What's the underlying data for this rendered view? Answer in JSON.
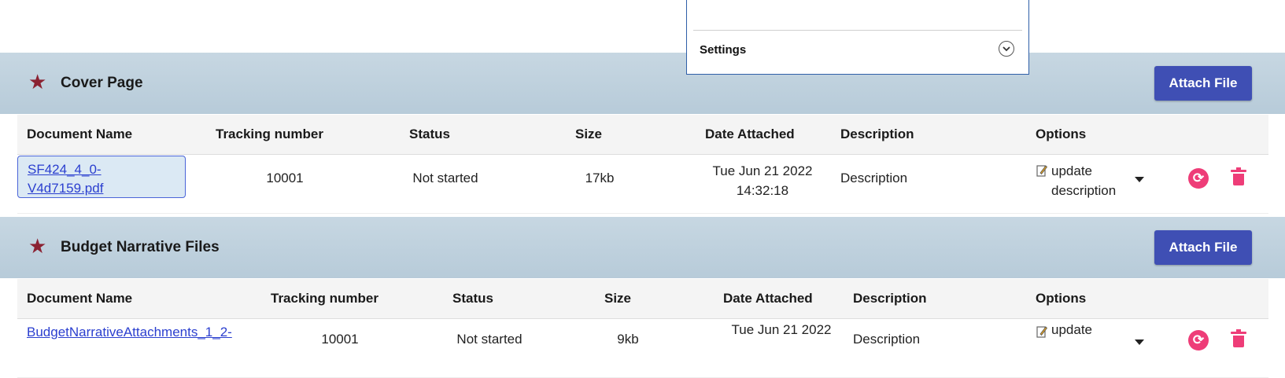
{
  "settings_popup": {
    "label": "Settings"
  },
  "sections": [
    {
      "title": "Cover Page",
      "attach_label": "Attach File",
      "headers": [
        "Document Name",
        "Tracking number",
        "Status",
        "Size",
        "Date Attached",
        "Description",
        "Options"
      ],
      "row": {
        "doc_line1": "SF424_4_0-",
        "doc_line2": "V4d7159.pdf",
        "tracking": "10001",
        "status": "Not started",
        "size": "17kb",
        "date_line1": "Tue Jun 21 2022",
        "date_line2": "14:32:18",
        "description": "Description",
        "option_line1": "update",
        "option_line2": "description"
      }
    },
    {
      "title": "Budget Narrative Files",
      "attach_label": "Attach File",
      "headers": [
        "Document Name",
        "Tracking number",
        "Status",
        "Size",
        "Date Attached",
        "Description",
        "Options"
      ],
      "row": {
        "doc_line1": "BudgetNarrativeAttachments_1_2-",
        "tracking": "10001",
        "status": "Not started",
        "size": "9kb",
        "date_line1": "Tue Jun 21 2022",
        "description": "Description",
        "option_line1": "update"
      }
    }
  ],
  "icons": {
    "star": "star-icon",
    "chevron": "chevron-down-icon",
    "edit": "edit-icon",
    "sync": "sync-icon",
    "trash": "trash-icon"
  },
  "colors": {
    "accent": "#3f4fb4",
    "star": "#8b2232",
    "danger": "#ee3d78",
    "link": "#2b3fcf"
  }
}
